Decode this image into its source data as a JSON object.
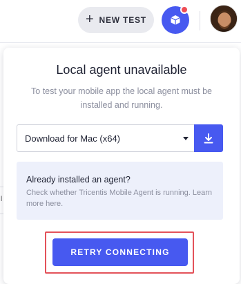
{
  "header": {
    "new_test_label": "NEW TEST",
    "new_test_icon": "plus-icon",
    "agent_icon": "cube-icon",
    "agent_status_color": "#ee4d55",
    "avatar_icon": "user-avatar"
  },
  "background": {
    "edge_text": "l"
  },
  "panel": {
    "title": "Local agent unavailable",
    "subtitle": "To test your mobile app the local agent must be installed and running.",
    "download_select": {
      "selected": "Download for Mac (x64)",
      "caret_icon": "caret-down-icon"
    },
    "download_icon": "download-icon",
    "info": {
      "title": "Already installed an agent?",
      "body": "Check whether Tricentis Mobile Agent is running. Learn more here."
    },
    "retry_label": "RETRY CONNECTING",
    "retry_highlight_color": "#e3525a"
  },
  "colors": {
    "accent": "#4759f0",
    "info_bg": "#edf0fb",
    "muted_text": "#8b8e9e"
  }
}
